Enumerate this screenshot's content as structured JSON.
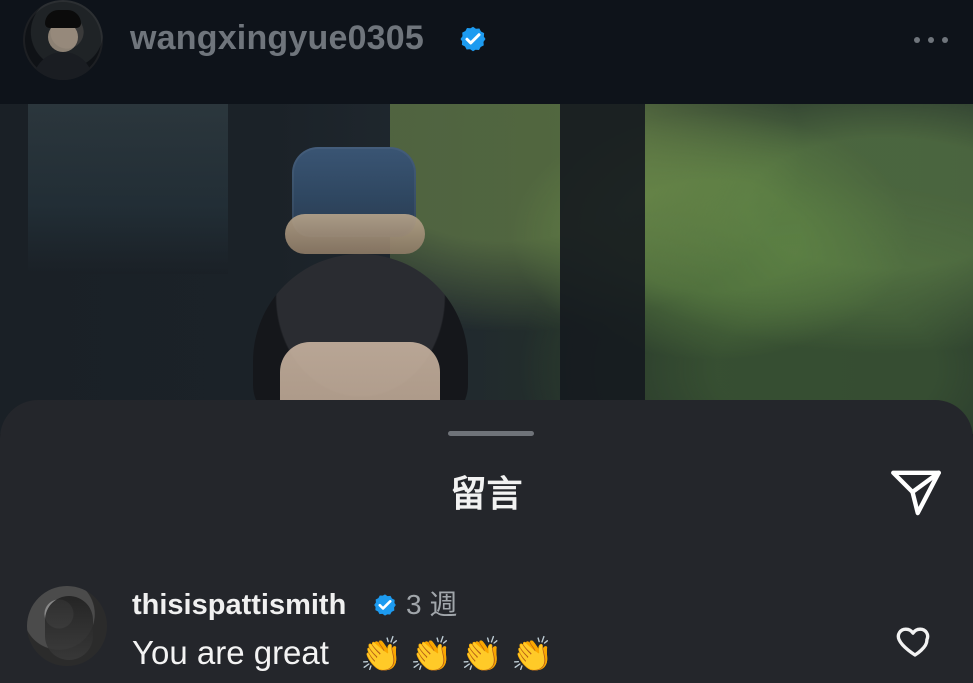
{
  "header": {
    "username": "wangxingyue0305"
  },
  "sheet": {
    "title": "留言"
  },
  "comment": {
    "username": "thisispattismith",
    "time": "3 週",
    "text": "You are great",
    "emojis": [
      "👏",
      "👏",
      "👏",
      "👏"
    ]
  },
  "colors": {
    "background": "#0b0f14",
    "sheet": "#24262b",
    "verified": "#1d9bf0",
    "muted_text": "#6f757c"
  },
  "icons": {
    "verified": "verified-badge-icon",
    "more": "more-icon",
    "send": "send-icon",
    "like": "heart-icon"
  }
}
